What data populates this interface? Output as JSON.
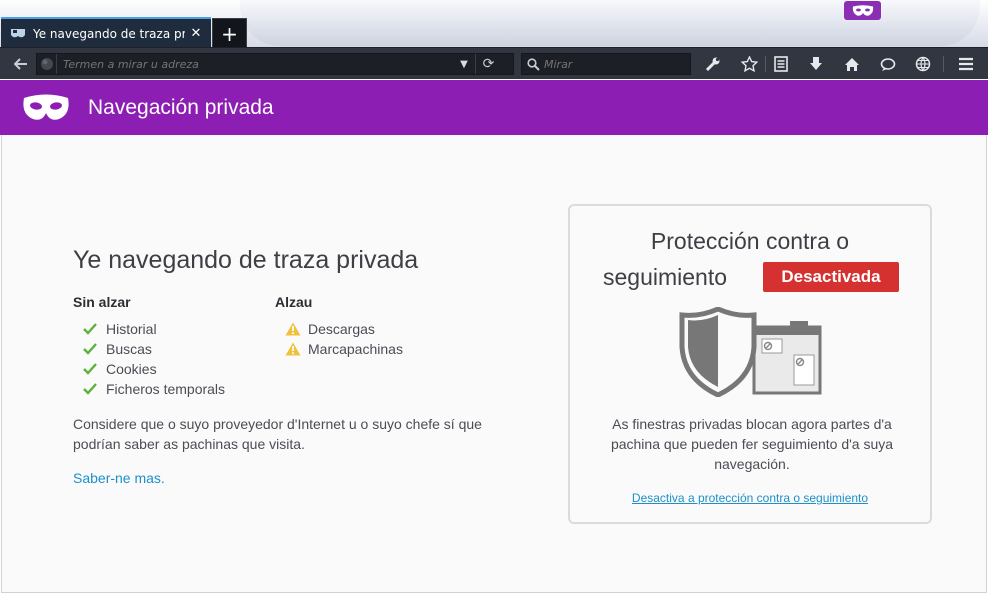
{
  "window": {
    "tab_title": "Ye navegando de traza priv...",
    "new_tab_label": "+"
  },
  "toolbar": {
    "url_placeholder": "Termen a mirar u adreza",
    "search_placeholder": "Mirar",
    "icons": [
      "back-icon",
      "site-identity-icon",
      "dropdown-icon",
      "reload-icon",
      "search-icon",
      "wrench-icon",
      "bookmark-star-icon",
      "reading-list-icon",
      "download-icon",
      "home-icon",
      "chat-icon",
      "globe-icon",
      "hamburger-menu-icon"
    ]
  },
  "header": {
    "title": "Navegación privada"
  },
  "main": {
    "title": "Ye navegando de traza privada",
    "not_saved_heading": "Sin alzar",
    "not_saved_items": [
      "Historial",
      "Buscas",
      "Cookies",
      "Ficheros temporals"
    ],
    "saved_heading": "Alzau",
    "saved_items": [
      "Descargas",
      "Marcapachinas"
    ],
    "note": "Considere que o suyo proveyedor d'Internet u o suyo chefe sí que podrían saber as pachinas que visita.",
    "learn_more": "Saber-ne mas."
  },
  "tracking_protection": {
    "title_line1": "Protección contra o",
    "title_line2": "seguimiento",
    "status_badge": "Desactivada",
    "description": "As finestras privadas blocan agora partes d'a pachina que pueden fer seguimiento d'a suya navegación.",
    "toggle_link": "Desactiva a protección contra o seguimiento"
  },
  "colors": {
    "private_purple": "#8d1eb3",
    "status_red": "#d53131",
    "link_blue": "#1d90c9",
    "check_green": "#5bb33a",
    "warning_yellow": "#f0c23c"
  }
}
